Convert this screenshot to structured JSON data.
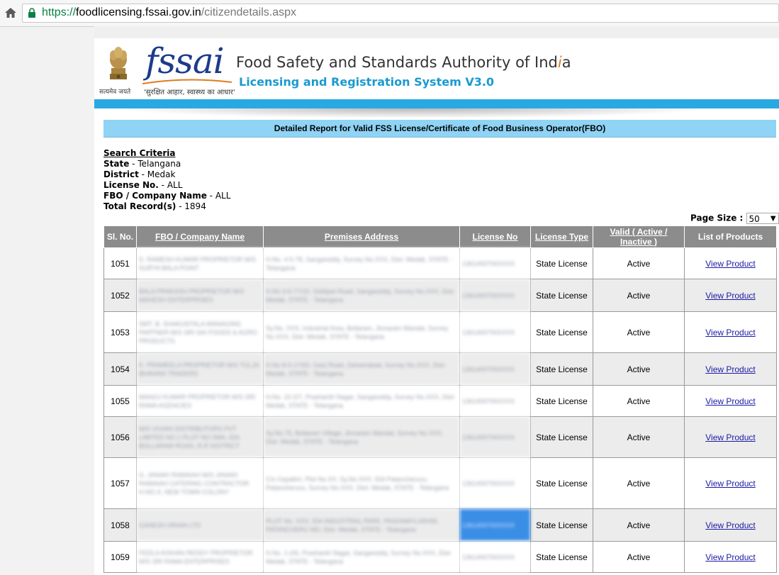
{
  "browser": {
    "url_scheme": "https://",
    "url_host": "foodlicensing.fssai.gov.in",
    "url_path": "/citizendetails.aspx"
  },
  "header": {
    "emblem_caption": "सत्यमेव जयते",
    "logo_text": "fssai",
    "logo_tagline": "'सुरक्षित आहार, स्वास्थ्य का आधार'",
    "org_name_main": "Food Safety and Standards Authority of Ind",
    "org_name_i": "i",
    "org_name_end": "a",
    "system_name": "Licensing and Registration System V3.0"
  },
  "report": {
    "title": "Detailed Report for Valid FSS License/Certificate of Food Business Operator(FBO)",
    "criteria_title": "Search Criteria",
    "criteria": [
      {
        "label": "State",
        "value": " - Telangana"
      },
      {
        "label": "District",
        "value": " - Medak"
      },
      {
        "label": "License No.",
        "value": " - ALL"
      },
      {
        "label": "FBO / Company Name",
        "value": " - ALL"
      },
      {
        "label": "Total Record(s)",
        "value": " - 1894"
      }
    ],
    "page_size_label": "Page Size :",
    "page_size_value": "50"
  },
  "table": {
    "headers": {
      "sl_no": "Sl. No.",
      "company": "FBO / Company Name",
      "address": "Premises Address",
      "license_no": "License No",
      "license_type": "License Type",
      "valid": "Valid ( Active / Inactive )",
      "products": "List of Products"
    },
    "rows": [
      {
        "sl": "1051",
        "company": "S. RAMESH KUMAR PROPRIETOR M/S SURYA BALA POINT",
        "address": "H.No. 4-5-78, Sangareddy, Survey No.XXX, Dist- Medak, STATE - Telangana",
        "lic": "1361400700XXXX",
        "type": "State License",
        "status": "Active",
        "link": "View Product"
      },
      {
        "sl": "1052",
        "company": "BALA PRAKASH PROPRIETOR M/S MAHESH ENTERPRISES",
        "address": "H.No 3-6-77/10, Siddipet Road, Sangareddy, Survey No.XXX, Dist- Medak, STATE - Telangana",
        "lic": "1361400700XXXX",
        "type": "State License",
        "status": "Active",
        "link": "View Product"
      },
      {
        "sl": "1053",
        "company": "SMT. B. SHAKUNTALA MANAGING PARTNER M/S SRI SAI FOODS & AGRO PRODUCTS",
        "address": "Sy.No. XXX, Industrial Area, Bollaram, Jinnaram Mandal, Survey No.XXX, Dist- Medak, STATE - Telangana",
        "lic": "1361400700XXXX",
        "type": "State License",
        "status": "Active",
        "link": "View Product"
      },
      {
        "sl": "1054",
        "company": "K. PRAMEELA PROPRIETOR M/S TULJA BHAVANI TRADERS",
        "address": "H.No 8-5-17/60, Ganj Road, Zaheerabad, Survey No.XXX, Dist- Medak, STATE - Telangana",
        "lic": "1361400700XXXX",
        "type": "State License",
        "status": "Active",
        "link": "View Product"
      },
      {
        "sl": "1055",
        "company": "MANOJ KUMAR PROPRIETOR M/S SRI RAMA AGENCIES",
        "address": "H.No. 10-2/7, Prashanth Nagar, Sangareddy, Survey No.XXX, Dist- Medak, STATE - Telangana",
        "lic": "1361400700XXXX",
        "type": "State License",
        "status": "Active",
        "link": "View Product"
      },
      {
        "sl": "1056",
        "company": "M/S VIVIAN DISTRIBUTORS PVT LIMITED NO.1 PLOT NO IIMA, IDA BOLLARAM ROAD, R.R DISTRICT",
        "address": "Sy.No.75, Bollaram Village, Jinnaram Mandal, Survey No.XXX, Dist- Medak, STATE - Telangana",
        "lic": "1361400700XXXX",
        "type": "State License",
        "status": "Active",
        "link": "View Product"
      },
      {
        "sl": "1057",
        "company": "G. JANAKI RAMAIAH M/S JANAKI RAMAIAH CATERING CONTRACTOR H.NO.X, NEW TOWN COLONY",
        "address": "C/o Gayathri, Plot No.XX, Sy.No.XXX, IDA Patancheruvu, Patancheruvu, Survey No.XXX, Dist- Medak, STATE - Telangana",
        "lic": "1361400700XXXX",
        "type": "State License",
        "status": "Active",
        "link": "View Product"
      },
      {
        "sl": "1058",
        "company": "GANESH DRAIN LTD",
        "address": "PLOT No. XXX, IDA INDUSTRIAL PARK, PASHAMYLARAM, PATANCHERU MD, Dist- Medak, STATE - Telangana",
        "lic": "1361400700XXXX",
        "type": "State License",
        "status": "Active",
        "link": "View Product"
      },
      {
        "sl": "1059",
        "company": "FEDLA KISHAN REDDY PROPRIETOR M/S SRI RAMA ENTERPRISES",
        "address": "H.No. 1-2/6, Prashanth Nagar, Sangareddy, Survey No.XXX, Dist- Medak, STATE - Telangana",
        "lic": "1361400700XXXX",
        "type": "State License",
        "status": "Active",
        "link": "View Product"
      }
    ]
  },
  "colors": {
    "blue_band": "#29a9e2",
    "title_bar": "#8fd3f5",
    "header_gray": "#8c8c8c",
    "link": "#1a1aa6"
  }
}
